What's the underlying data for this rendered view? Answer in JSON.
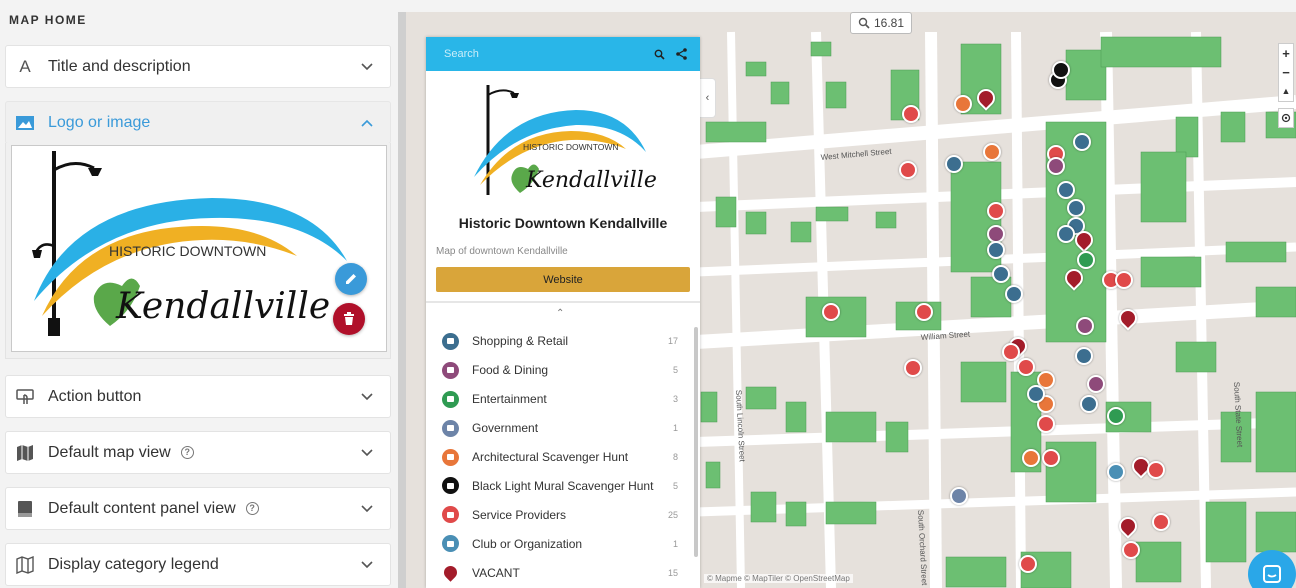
{
  "left_panel": {
    "title": "MAP HOME",
    "sections": {
      "title_description": "Title and description",
      "logo_image": "Logo or image",
      "action_button": "Action button",
      "default_map_view": "Default map view",
      "default_content_panel_view": "Default content panel view",
      "display_category_legend": "Display category legend"
    },
    "help_glyph": "?"
  },
  "logo": {
    "top_text": "HISTORIC DOWNTOWN",
    "script_text": "Kendallville"
  },
  "map": {
    "zoom_level": "16.81",
    "controls": {
      "zoom_in": "+",
      "zoom_out": "−"
    },
    "streets": {
      "west_mitchell": "West Mitchell Street",
      "william": "William Street",
      "south_lincoln": "South Lincoln Street",
      "south_orchard": "South Orchard Street",
      "south_state": "South State Street"
    },
    "attribution": "© Mapme  © MapTiler  © OpenStreetMap",
    "colors": {
      "building": "#6cbf72",
      "block": "#e6e1dc",
      "street": "#ffffff",
      "vacant": "#a31c2a"
    }
  },
  "content_panel": {
    "search_placeholder": "Search",
    "title": "Historic Downtown Kendallville",
    "description": "Map of downtown Kendallville",
    "website_button": "Website",
    "categories": [
      {
        "name": "Shopping & Retail",
        "count": "17",
        "color": "#3c6e8f"
      },
      {
        "name": "Food & Dining",
        "count": "5",
        "color": "#8e4a7a"
      },
      {
        "name": "Entertainment",
        "count": "3",
        "color": "#2f9b52"
      },
      {
        "name": "Government",
        "count": "1",
        "color": "#6d84a8"
      },
      {
        "name": "Architectural Scavenger Hunt",
        "count": "8",
        "color": "#e8763a"
      },
      {
        "name": "Black Light Mural Scavenger Hunt",
        "count": "5",
        "color": "#111111"
      },
      {
        "name": "Service Providers",
        "count": "25",
        "color": "#e04a4a"
      },
      {
        "name": "Club or Organization",
        "count": "1",
        "color": "#4a8fb5"
      },
      {
        "name": "VACANT",
        "count": "15",
        "color": "#a31c2a"
      }
    ]
  }
}
